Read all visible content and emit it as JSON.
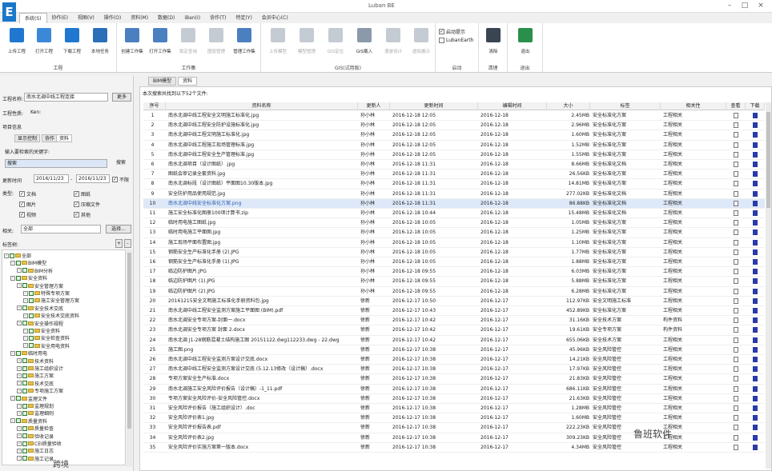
{
  "app": {
    "window_title": "Luban BE",
    "logo": "E"
  },
  "menu": [
    "系统(S)",
    "协作(E)",
    "视图(V)",
    "操作(O)",
    "资料(M)",
    "数据(D)",
    "iBan(I)",
    "协作(T)",
    "特定(Y)",
    "会员中心(C)"
  ],
  "ribbon": {
    "groups": [
      {
        "label": "工程",
        "buttons": [
          "上传工程",
          "打开工程",
          "下载工程",
          "本地任务"
        ]
      },
      {
        "label": "工作集",
        "buttons": [
          "创建工作集",
          "打开工作集",
          "锁定查询",
          "图层管理",
          "管理工作集"
        ]
      },
      {
        "label": "GIS(试用版)",
        "buttons": [
          "上传模型",
          "模型管理",
          "GIS定位",
          "GIS载入",
          "漫游设计",
          "虚拟展示"
        ]
      },
      {
        "label": "启动",
        "checks": [
          "启动提示",
          "LubanEarth"
        ]
      },
      {
        "label": "清理",
        "buttons": [
          "清除"
        ]
      },
      {
        "label": "退出",
        "buttons": [
          "退出"
        ]
      }
    ]
  },
  "left": {
    "project_label": "工程名称:",
    "project_value": "南水北调中线工程连接",
    "project_btn": "更多",
    "tag_label": "工程性质:",
    "tag_value": "Ken:",
    "section": "项目信息",
    "tabs": [
      "显示控制",
      "协作",
      "资料"
    ],
    "search_label": "输入要检索的关键字:",
    "search_value": "搜索",
    "search_btn": "搜索",
    "date_label": "更新时间",
    "date_from": "2016/11/23",
    "date_to": "2016/11/23",
    "date_check": "不限",
    "type_label": "类型:",
    "types": [
      "文档",
      "图纸",
      "图片",
      "压缩文件",
      "视频",
      "其他"
    ],
    "related_label": "相关:",
    "related_value": "全部",
    "related_btn": "选择...",
    "tag_section": "标签树:",
    "tree": [
      "全部",
      "BIM模型",
      "BIM分析",
      "安全资料",
      "安全管理方案",
      "特殊专项方案",
      "施工安全管理方案",
      "安全技术交底",
      "安全技术交底资料",
      "安全操作规程",
      "安全资料",
      "安全检查资料",
      "安全用电资料",
      "临时用电",
      "技术资料",
      "施工组织设计",
      "施工方案",
      "技术交底",
      "专项施工方案",
      "监理文件",
      "监理规划",
      "监理细则",
      "质量资料",
      "质量检查",
      "验收记录",
      "CEI质量验收",
      "施工日志",
      "施工记录"
    ]
  },
  "doc_tabs": [
    "BIM模型",
    "资料"
  ],
  "summary": "本次搜索共找到以下52个文件:",
  "columns": [
    "序号",
    "资料名称",
    "更新人",
    "更新时间",
    "编辑时间",
    "大小",
    "标签",
    "相关性",
    "查看",
    "下载"
  ],
  "rows": [
    [
      "1",
      "南水北调中线工程安全文明施工标准化.jpg",
      "孙小林",
      "2016-12-18 12:05",
      "2016-12-18",
      "2.45MB",
      "安全标准化方案",
      "工程相关"
    ],
    [
      "2",
      "南水北调中线工程安全防护设施标准化.jpg",
      "孙小林",
      "2016-12-18 12:05",
      "2016-12-18",
      "2.96MB",
      "安全标准化方案",
      "工程相关"
    ],
    [
      "3",
      "南水北调中线工程文明施工标准化.jpg",
      "孙小林",
      "2016-12-18 12:05",
      "2016-12-18",
      "1.60MB",
      "安全标准化方案",
      "工程相关"
    ],
    [
      "4",
      "南水北调中线工程施工现场管理标准.jpg",
      "孙小林",
      "2016-12-18 12:05",
      "2016-12-18",
      "1.52MB",
      "安全标准化方案",
      "工程相关"
    ],
    [
      "5",
      "南水北调中线工程安全生产管理标准.jpg",
      "孙小林",
      "2016-12-18 12:05",
      "2016-12-18",
      "1.55MB",
      "安全标准化方案",
      "工程相关"
    ],
    [
      "6",
      "南水北调项目（设计图纸）.jpg",
      "孙小林",
      "2016-12-18 11:31",
      "2016-12-18",
      "8.66MB",
      "安全标准化文档",
      "工程相关"
    ],
    [
      "7",
      "图纸会审记录全套资料.jpg",
      "孙小林",
      "2016-12-18 11:31",
      "2016-12-18",
      "26.56KB",
      "安全标准化方案",
      "工程相关"
    ],
    [
      "8",
      "南水北调标段（设计图纸）平面图10.30版本.jpg",
      "孙小林",
      "2016-12-18 11:31",
      "2016-12-18",
      "14.81MB",
      "安全标准化方案",
      "工程相关"
    ],
    [
      "9",
      "安全防护用品使用规范.jpg",
      "孙小林",
      "2016-12-18 11:31",
      "2016-12-18",
      "277.02KB",
      "安全标准化文档",
      "工程相关"
    ],
    [
      "10",
      "南水北调中线安全标准化方案.png",
      "孙小林",
      "2016-12-18 11:31",
      "2016-12-18",
      "86.88KB",
      "安全标准化文档",
      "工程相关"
    ],
    [
      "11",
      "施工安全标准化图册100项计算书.zip",
      "孙小林",
      "2016-12-18 10:44",
      "2016-12-18",
      "15.48MB",
      "安全标准化文档",
      "工程相关"
    ],
    [
      "12",
      "临时用电施工图纸.jpg",
      "孙小林",
      "2016-12-18 10:05",
      "2016-12-18",
      "1.05MB",
      "安全标准化方案",
      "工程相关"
    ],
    [
      "13",
      "临时用电施工平面图.jpg",
      "孙小林",
      "2016-12-18 10:05",
      "2016-12-18",
      "1.25MB",
      "安全标准化方案",
      "工程相关"
    ],
    [
      "14",
      "施工现场平面布置图.jpg",
      "孙小林",
      "2016-12-18 10:05",
      "2016-12-18",
      "1.10MB",
      "安全标准化方案",
      "工程相关"
    ],
    [
      "15",
      "钢筋安全生产标准化手册 (2).JPG",
      "孙小林",
      "2016-12-18 10:05",
      "2016-12-18",
      "1.77MB",
      "安全标准化方案",
      "工程相关"
    ],
    [
      "16",
      "钢筋安全生产标准化手册 (1).JPG",
      "孙小林",
      "2016-12-18 10:05",
      "2016-12-18",
      "1.88MB",
      "安全标准化方案",
      "工程相关"
    ],
    [
      "17",
      "临边防护图片.JPG",
      "孙小林",
      "2016-12-18 09:55",
      "2016-12-18",
      "6.03MB",
      "安全标准化方案",
      "工程相关"
    ],
    [
      "18",
      "临边防护图片 (1).JPG",
      "孙小林",
      "2016-12-18 09:55",
      "2016-12-18",
      "5.88MB",
      "安全标准化方案",
      "工程相关"
    ],
    [
      "19",
      "临边防护图片 (2).JPG",
      "孙小林",
      "2016-12-18 09:55",
      "2016-12-18",
      "6.28MB",
      "安全标准化方案",
      "工程相关"
    ],
    [
      "20",
      "20161215安全文明施工标准化手册资料包.jpg",
      "徐新",
      "2016-12-17 10:50",
      "2016-12-17",
      "112.97KB",
      "安全文明施工标准",
      "工程相关"
    ],
    [
      "21",
      "南水北调中线工程安全监测方案施工平面图 (BIM).pdf",
      "徐新",
      "2016-12-17 10:43",
      "2016-12-17",
      "452.89KB",
      "安全标准化方案",
      "工程相关"
    ],
    [
      "22",
      "南水北调安全专项方案-封面一.docx",
      "徐新",
      "2016-12-17 10:42",
      "2016-12-17",
      "31.16KB",
      "安全技术方案",
      "构件资料"
    ],
    [
      "23",
      "南水北调安全专项方案 封面 2.docx",
      "徐新",
      "2016-12-17 10:42",
      "2016-12-17",
      "19.61KB",
      "安全专项方案",
      "构件资料"
    ],
    [
      "24",
      "南水北调 J1-28钢筋混凝土结构施工图 20151122.dwg112233.dwg - 22.dwg",
      "徐新",
      "2016-12-17 10:42",
      "2016-12-17",
      "655.06KB",
      "安全技术方案",
      "工程相关"
    ],
    [
      "25",
      "施工图.png",
      "徐新",
      "2016-12-17 10:38",
      "2016-12-17",
      "45.96KB",
      "安全风险管控",
      "工程相关"
    ],
    [
      "26",
      "南水北调中线工程安全监测方案设计交底.docx",
      "徐新",
      "2016-12-17 10:38",
      "2016-12-17",
      "14.21KB",
      "安全风险管控",
      "工程相关"
    ],
    [
      "27",
      "南水北调中线工程安全监测方案设计交底 (5.12.13修改（设计稿）.docx",
      "徐新",
      "2016-12-17 10:38",
      "2016-12-17",
      "17.97KB",
      "安全风险管控",
      "工程相关"
    ],
    [
      "28",
      "专项方案安全生产标准.docx",
      "徐新",
      "2016-12-17 10:38",
      "2016-12-17",
      "21.83KB",
      "安全风险管控",
      "工程相关"
    ],
    [
      "29",
      "南水北调施工安全风险评价报告（设计稿）-1_11.pdf",
      "徐新",
      "2016-12-17 10:38",
      "2016-12-17",
      "686.11KB",
      "安全风险管控",
      "工程相关"
    ],
    [
      "30",
      "专项方案安全风险评价-安全风险管控.docx",
      "徐新",
      "2016-12-17 10:38",
      "2016-12-17",
      "21.63KB",
      "安全风险管控",
      "工程相关"
    ],
    [
      "31",
      "安全风险评价报告（施工组织设计）.doc",
      "徐新",
      "2016-12-17 10:38",
      "2016-12-17",
      "1.28MB",
      "安全风险管控",
      "工程相关"
    ],
    [
      "32",
      "安全风险评价表1.jpg",
      "徐新",
      "2016-12-17 10:38",
      "2016-12-17",
      "1.60MB",
      "安全风险管控",
      "工程相关"
    ],
    [
      "33",
      "安全风险评价报告表.pdf",
      "徐新",
      "2016-12-17 10:38",
      "2016-12-17",
      "222.23KB",
      "安全风险管控",
      "工程相关"
    ],
    [
      "34",
      "安全风险评价表2.jpg",
      "徐新",
      "2016-12-17 10:38",
      "2016-12-17",
      "309.23KB",
      "安全风险管控",
      "工程相关"
    ],
    [
      "35",
      "安全风险评价实施方案第一版本.docx",
      "徐新",
      "2016-12-17 10:38",
      "2016-12-17",
      "4.34MB",
      "安全风险管控",
      "工程相关"
    ]
  ],
  "watermark1": "鲁班软件",
  "watermark2": "跨境"
}
